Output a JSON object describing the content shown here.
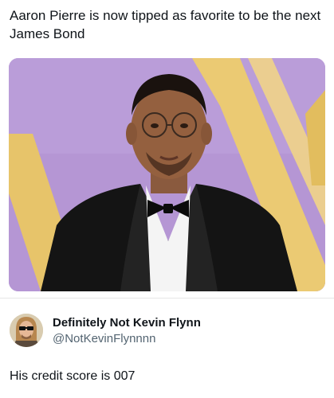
{
  "post": {
    "text": "Aaron Pierre is now tipped as favorite to be the next James Bond",
    "media": {
      "description_icon": "photo"
    }
  },
  "reply": {
    "author": {
      "display_name": "Definitely Not Kevin Flynn",
      "handle": "@NotKevinFlynnnn",
      "avatar_icon": "avatar-sunglasses"
    },
    "text": "His credit score is 007"
  },
  "colors": {
    "background": "#ffffff",
    "text_primary": "#0f1419",
    "text_secondary": "#536471",
    "backdrop_purple": "#b596d4",
    "backdrop_gold": "#e8c56a"
  }
}
